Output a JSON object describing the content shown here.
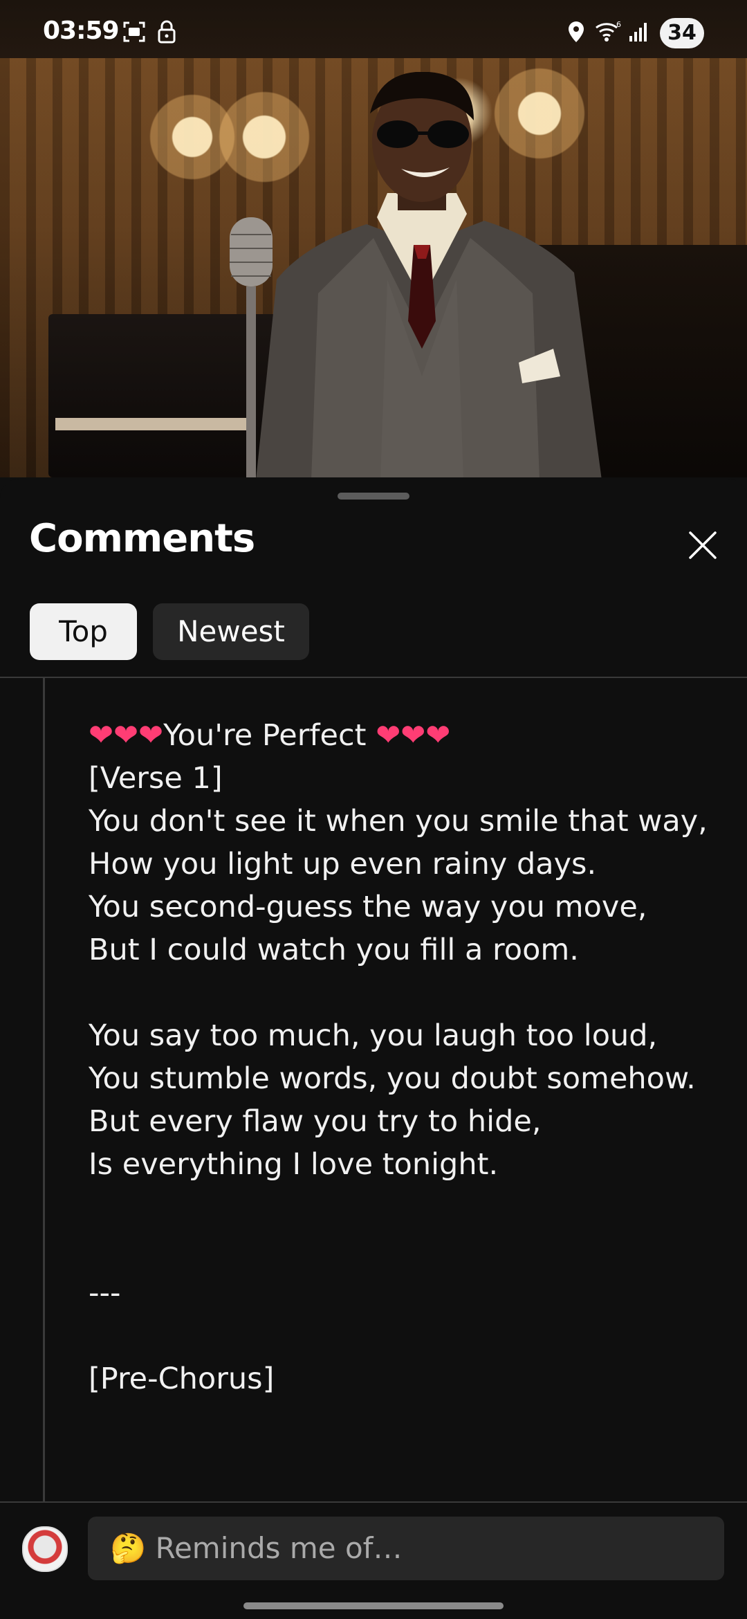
{
  "status_bar": {
    "time": "03:59",
    "battery": "34",
    "icons": [
      "screenshot-icon",
      "lock-icon",
      "location-icon",
      "wifi-icon",
      "signal-icon"
    ]
  },
  "video": {
    "progress": 0.05
  },
  "comments_sheet": {
    "title": "Comments",
    "close_icon": "close-icon",
    "filters": [
      {
        "label": "Top",
        "selected": true
      },
      {
        "label": "Newest",
        "selected": false
      }
    ],
    "comment": {
      "title_hearts_left": "❤❤❤",
      "title_text": "You're Perfect ",
      "title_hearts_right": "❤❤❤",
      "body": "\n[Verse 1]\nYou don't see it when you smile that way,\nHow you light up even rainy days.\nYou second-guess the way you move,\nBut I could watch you fill a room.\n\nYou say too much, you laugh too loud,\nYou stumble words, you doubt somehow.\nBut every flaw you try to hide,\nIs everything I love tonight.\n\n\n---\n\n[Pre-Chorus]"
    },
    "input": {
      "placeholder": "🤔 Reminds me of…"
    }
  },
  "colors": {
    "background": "#0f0f0f",
    "chip_selected": "#f1f1f1",
    "chip_unselected": "#272727",
    "heart": "#ff3d74"
  }
}
